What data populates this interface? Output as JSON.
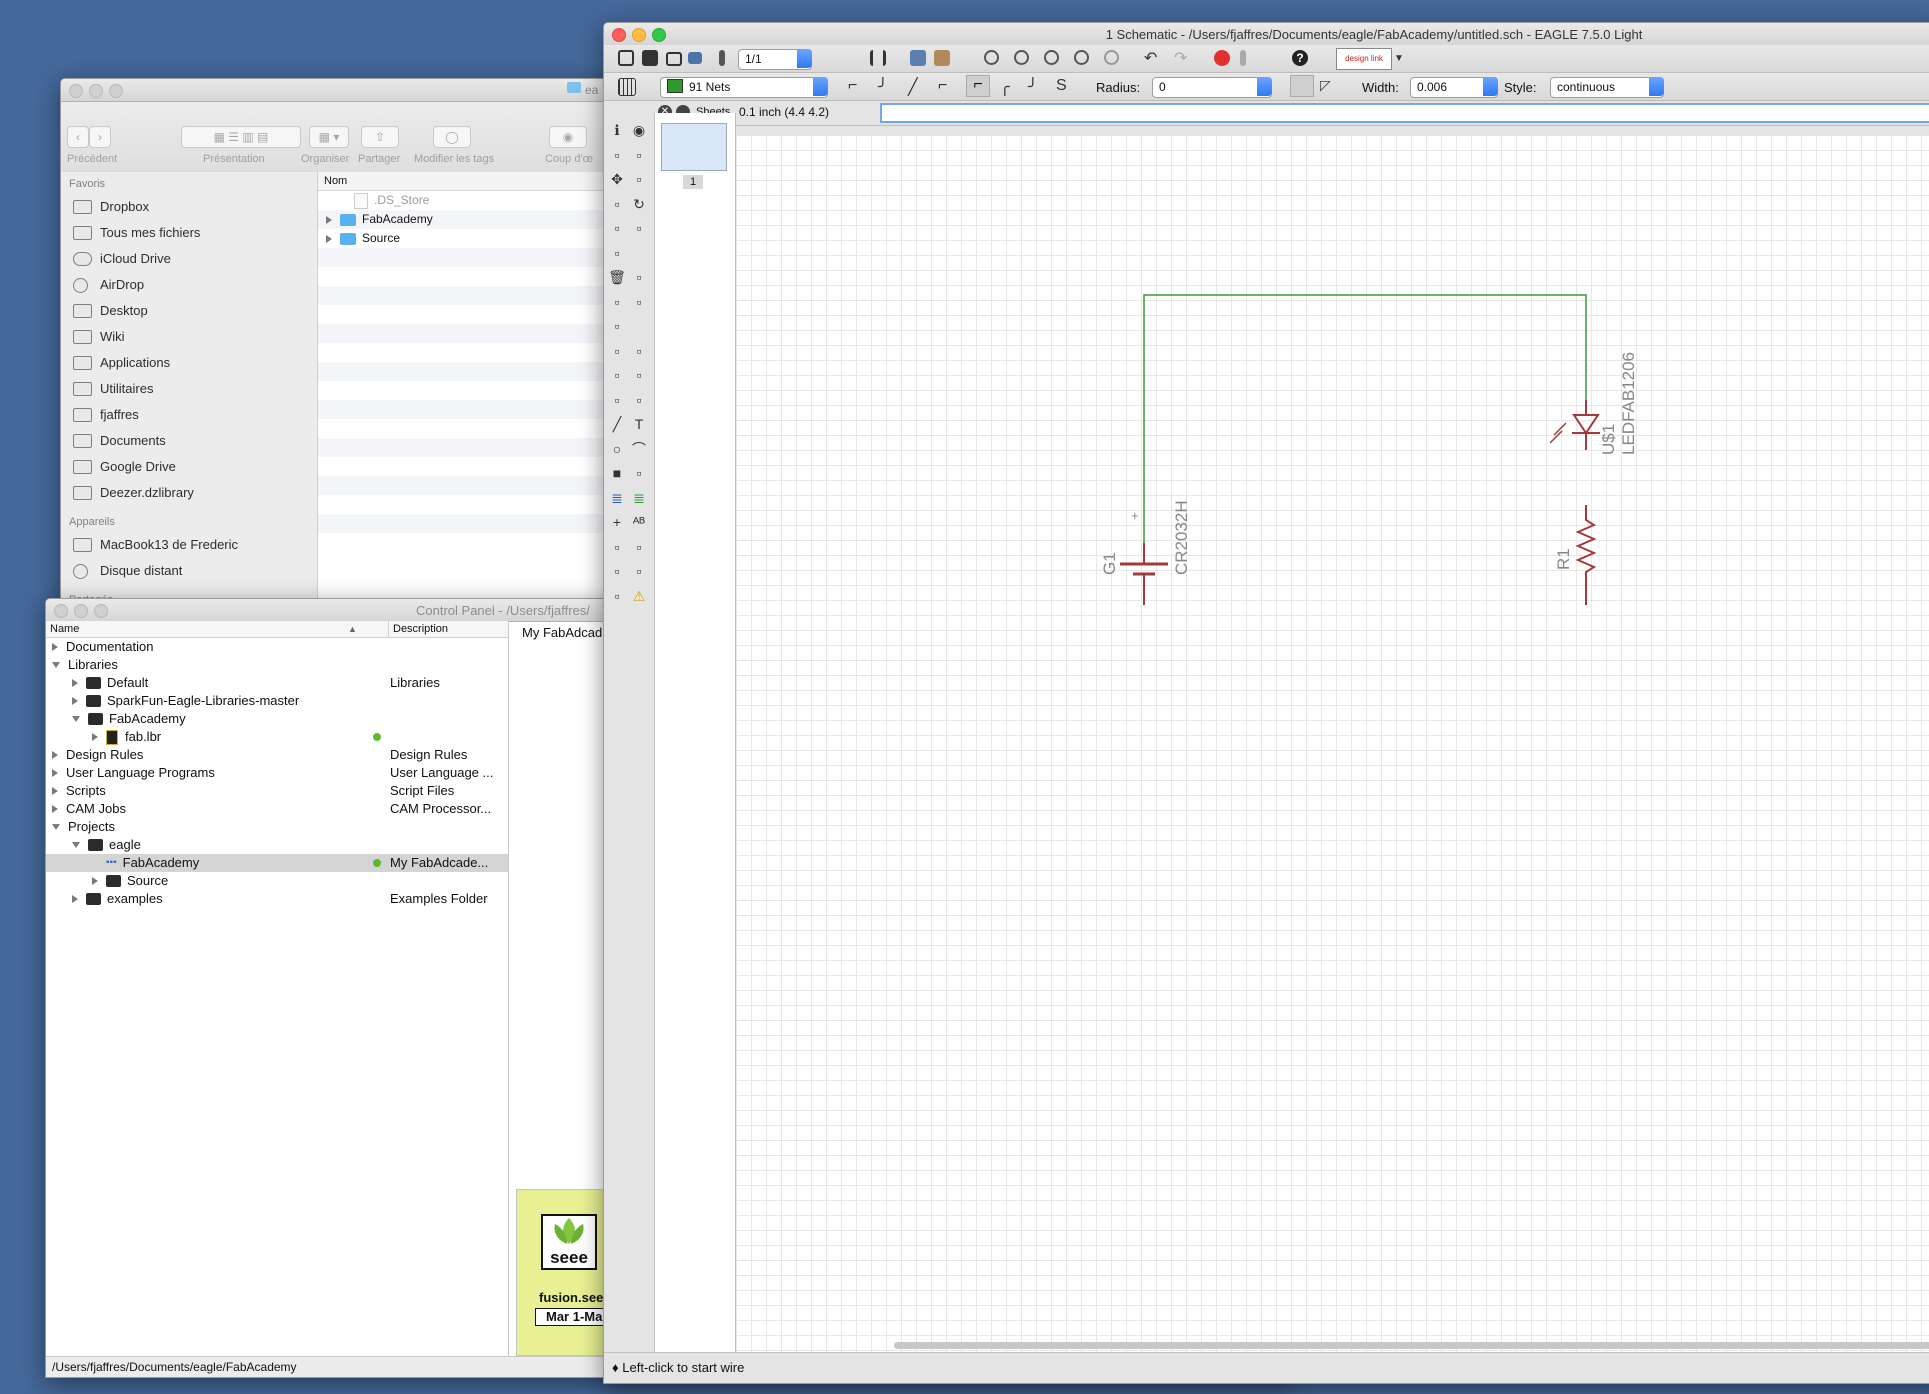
{
  "finder": {
    "title": "ea",
    "toolbar": {
      "back_label": "Précédent",
      "view_label": "Présentation",
      "arrange_label": "Organiser",
      "share_label": "Partager",
      "tags_label": "Modifier les tags",
      "quicklook_label": "Coup d'œ"
    },
    "sidebar": {
      "favorites_heading": "Favoris",
      "favorites": [
        "Dropbox",
        "Tous mes fichiers",
        "iCloud Drive",
        "AirDrop",
        "Desktop",
        "Wiki",
        "Applications",
        "Utilitaires",
        "fjaffres",
        "Documents",
        "Google Drive",
        "Deezer.dzlibrary"
      ],
      "devices_heading": "Appareils",
      "devices": [
        "MacBook13 de Frederic",
        "Disque distant"
      ],
      "shared_heading": "Partagés"
    },
    "list": {
      "column_name": "Nom",
      "items": [
        ".DS_Store",
        "FabAcademy",
        "Source"
      ]
    }
  },
  "control_panel": {
    "title": "Control Panel - /Users/fjaffres/",
    "columns": {
      "name": "Name",
      "description": "Description"
    },
    "tree": [
      {
        "name": "Documentation",
        "desc": "",
        "level": 0,
        "open": false,
        "folder": false
      },
      {
        "name": "Libraries",
        "desc": "",
        "level": 0,
        "open": true,
        "folder": false
      },
      {
        "name": "Default",
        "desc": "Libraries",
        "level": 1,
        "open": false,
        "folder": true
      },
      {
        "name": "SparkFun-Eagle-Libraries-master",
        "desc": "",
        "level": 1,
        "open": false,
        "folder": true
      },
      {
        "name": "FabAcademy",
        "desc": "",
        "level": 1,
        "open": true,
        "folder": true
      },
      {
        "name": "fab.lbr",
        "desc": "",
        "level": 2,
        "open": false,
        "folder": false,
        "dot": true,
        "lib": true
      },
      {
        "name": "Design Rules",
        "desc": "Design Rules",
        "level": 0,
        "open": false,
        "folder": false
      },
      {
        "name": "User Language Programs",
        "desc": "User Language ...",
        "level": 0,
        "open": false,
        "folder": false
      },
      {
        "name": "Scripts",
        "desc": "Script Files",
        "level": 0,
        "open": false,
        "folder": false
      },
      {
        "name": "CAM Jobs",
        "desc": "CAM Processor...",
        "level": 0,
        "open": false,
        "folder": false
      },
      {
        "name": "Projects",
        "desc": "",
        "level": 0,
        "open": true,
        "folder": false
      },
      {
        "name": "eagle",
        "desc": "",
        "level": 1,
        "open": true,
        "folder": true
      },
      {
        "name": "FabAcademy",
        "desc": "My FabAdcade...",
        "level": 2,
        "open": false,
        "folder": false,
        "dot": true,
        "selected": true,
        "project": true
      },
      {
        "name": "Source",
        "desc": "",
        "level": 2,
        "open": false,
        "folder": true
      },
      {
        "name": "examples",
        "desc": "Examples Folder",
        "level": 1,
        "open": false,
        "folder": true
      }
    ],
    "info_text": "My FabAdcad",
    "ad": {
      "brand": "seee",
      "site": "fusion.see",
      "dates": "Mar 1-Ma"
    },
    "status_path": "/Users/fjaffres/Documents/eagle/FabAcademy"
  },
  "eagle": {
    "title": "1 Schematic - /Users/fjaffres/Documents/eagle/FabAcademy/untitled.sch - EAGLE 7.5.0 Light",
    "sheet_selector": "1/1",
    "designlink_label": "design link",
    "layer": {
      "label": "91 Nets",
      "color": "#2e9a2e"
    },
    "radius_label": "Radius:",
    "radius_value": "0",
    "width_label": "Width:",
    "width_value": "0.006",
    "style_label": "Style:",
    "style_value": "continuous",
    "sheets_label": "Sheets",
    "sheet_number": "1",
    "grid_readout": "0.1 inch (4.4 4.2)",
    "command_value": "",
    "status_text": "♦ Left-click to start wire",
    "schematic": {
      "battery_name": "G1",
      "battery_value": "CR2032H",
      "battery_plus": "+",
      "led_name": "U$1",
      "led_value": "LEDFAB1206",
      "resistor_name": "R1",
      "net_color": "#3a9a3a",
      "part_color": "#a33a3a"
    }
  }
}
